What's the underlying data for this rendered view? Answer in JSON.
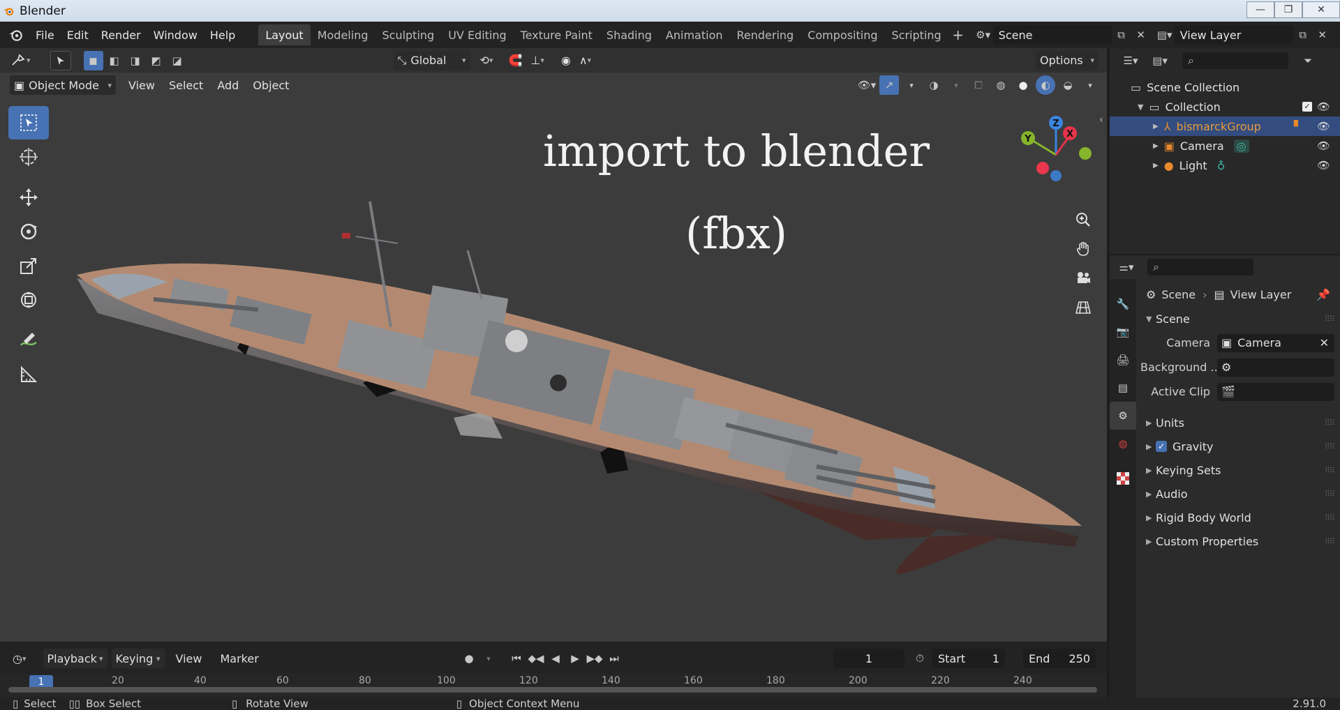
{
  "window": {
    "title": "Blender"
  },
  "menu": {
    "items": [
      "File",
      "Edit",
      "Render",
      "Window",
      "Help"
    ]
  },
  "workspaces": {
    "tabs": [
      "Layout",
      "Modeling",
      "Sculpting",
      "UV Editing",
      "Texture Paint",
      "Shading",
      "Animation",
      "Rendering",
      "Compositing",
      "Scripting"
    ],
    "active": "Layout"
  },
  "scene_selector": {
    "value": "Scene"
  },
  "view_layer_selector": {
    "value": "View Layer"
  },
  "viewport": {
    "transform_orientation": "Global",
    "options_label": "Options",
    "mode": "Object Mode",
    "header_menus": [
      "View",
      "Select",
      "Add",
      "Object"
    ],
    "overlay_line1": "import to blender",
    "overlay_line2": "(fbx)",
    "gizmo_axes": {
      "z": "Z",
      "y": "Y",
      "x": "X"
    },
    "colors": {
      "x": "#e6344a",
      "y": "#86b52c",
      "z": "#3b84e0",
      "x_neg": "#e8374e",
      "y_neg": "#6fa030",
      "z_neg": "#3c7ac5"
    }
  },
  "timeline": {
    "menus": [
      "Playback",
      "Keying",
      "View",
      "Marker"
    ],
    "current_frame": "1",
    "start_label": "Start",
    "start_value": "1",
    "end_label": "End",
    "end_value": "250",
    "ruler_ticks": [
      "1",
      "20",
      "40",
      "60",
      "80",
      "100",
      "120",
      "140",
      "160",
      "180",
      "200",
      "220",
      "240"
    ]
  },
  "statusbar": {
    "items": [
      "Select",
      "Box Select",
      "Rotate View",
      "Object Context Menu"
    ],
    "version": "2.91.0"
  },
  "outliner": {
    "root": "Scene Collection",
    "collection": "Collection",
    "objects": [
      {
        "name": "bismarckGroup",
        "selected": true
      },
      {
        "name": "Camera",
        "selected": false
      },
      {
        "name": "Light",
        "selected": false
      }
    ]
  },
  "properties": {
    "breadcrumb_scene": "Scene",
    "breadcrumb_view_layer": "View Layer",
    "section_title": "Scene",
    "camera_label": "Camera",
    "camera_value": "Camera",
    "background_label": "Background ...",
    "active_clip_label": "Active Clip",
    "subsections": [
      "Units",
      "Gravity",
      "Keying Sets",
      "Audio",
      "Rigid Body World",
      "Custom Properties"
    ],
    "gravity_enabled": true
  }
}
